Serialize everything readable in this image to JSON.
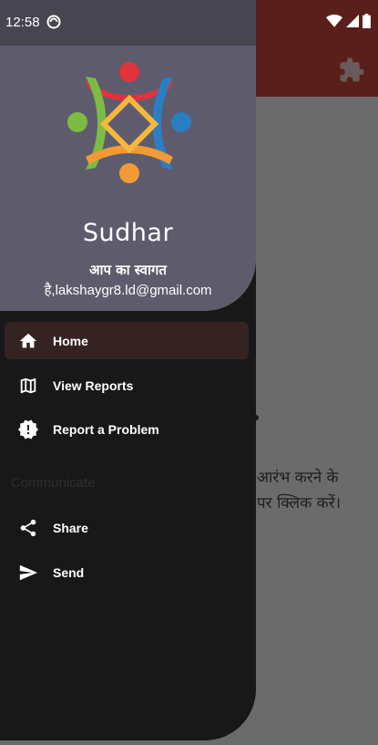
{
  "status_bar": {
    "time": "12:58"
  },
  "drawer": {
    "app_name": "Sudhar",
    "welcome_text": "आप का स्वागत",
    "email": "है,lakshaygr8.ld@gmail.com",
    "nav_items": [
      {
        "label": "Home",
        "icon": "home-icon",
        "active": true
      },
      {
        "label": "View Reports",
        "icon": "map-icon",
        "active": false
      },
      {
        "label": "Report a Problem",
        "icon": "report-icon",
        "active": false
      }
    ],
    "section_title": "Communicate",
    "communicate_items": [
      {
        "label": "Share",
        "icon": "share-icon"
      },
      {
        "label": "Send",
        "icon": "send-icon"
      }
    ]
  },
  "background": {
    "line1": "आरंभ करने के",
    "line2": "पर क्लिक करें।"
  },
  "colors": {
    "app_bar": "#5b1f1b",
    "header": "#5e5c6c",
    "drawer": "#181818",
    "active_item": "#352322"
  }
}
